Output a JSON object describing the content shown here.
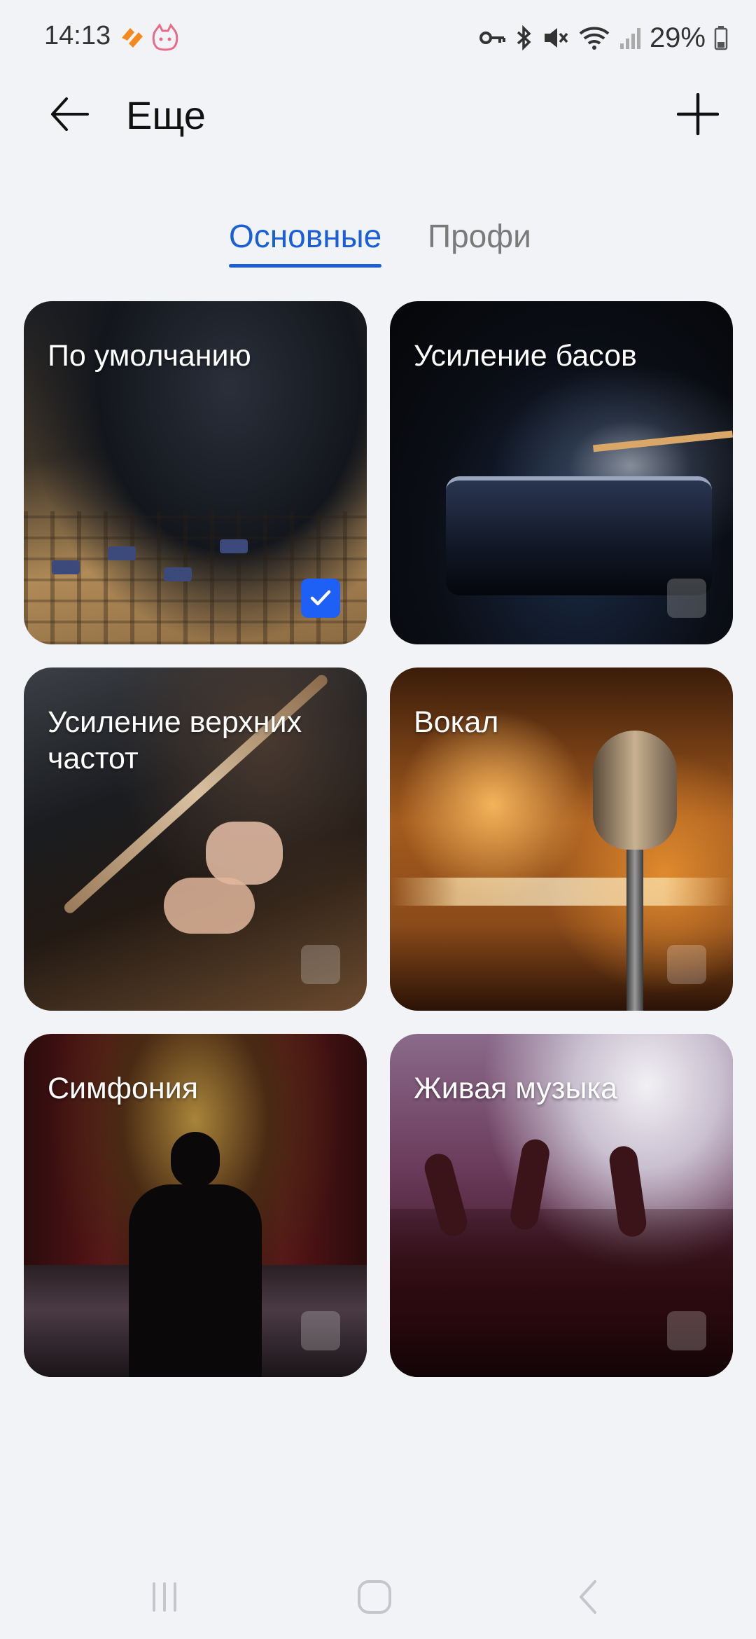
{
  "status_bar": {
    "time": "14:13",
    "battery_percent": "29%",
    "icons": [
      "key-icon",
      "bluetooth-icon",
      "mute-icon",
      "wifi-icon",
      "signal-icon",
      "battery-icon"
    ]
  },
  "header": {
    "title": "Еще",
    "back_icon": "arrow-left-icon",
    "add_icon": "plus-icon"
  },
  "tabs": [
    {
      "label": "Основные",
      "active": true
    },
    {
      "label": "Профи",
      "active": false
    }
  ],
  "presets": [
    {
      "label": "По умолчанию",
      "selected": true
    },
    {
      "label": "Усиление басов",
      "selected": false
    },
    {
      "label": "Усиление верхних частот",
      "selected": false
    },
    {
      "label": "Вокал",
      "selected": false
    },
    {
      "label": "Симфония",
      "selected": false
    },
    {
      "label": "Живая музыка",
      "selected": false
    }
  ],
  "colors": {
    "accent": "#1a5fd8",
    "checkbox_checked": "#1e5ff5",
    "background": "#f2f3f6"
  },
  "navigation": [
    "recent-apps-icon",
    "home-icon",
    "back-icon"
  ]
}
